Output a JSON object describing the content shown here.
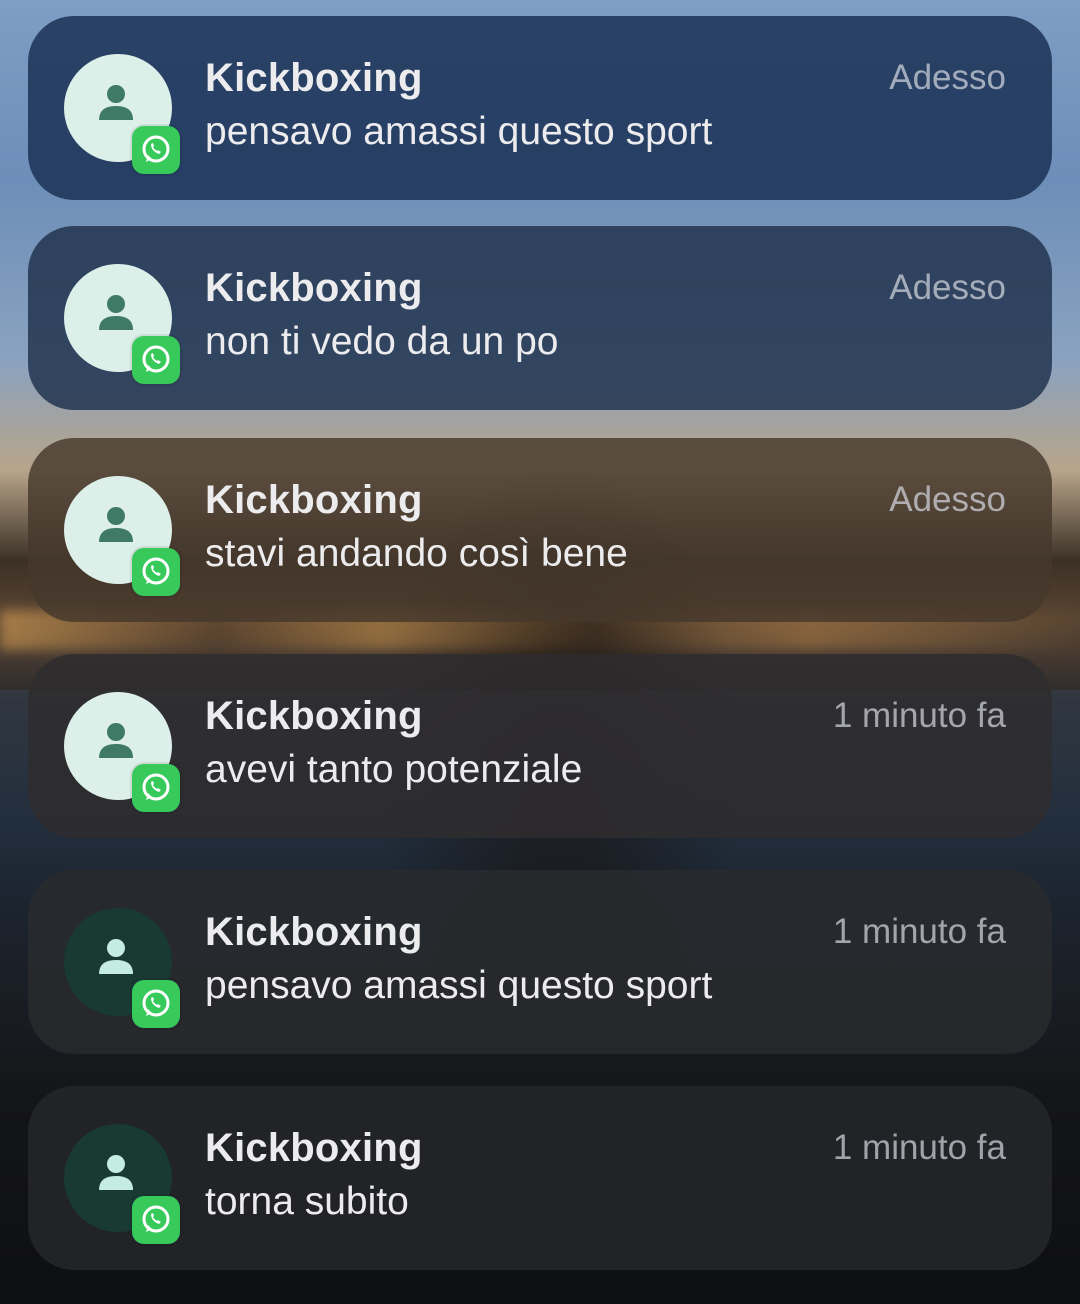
{
  "colors": {
    "badge_green": "#37c95a",
    "avatar_light": "#dcefe9",
    "avatar_dark": "#183a32",
    "text_primary": "#ececee"
  },
  "notifications": [
    {
      "app_icon": "whatsapp-icon",
      "avatar_icon": "person-icon",
      "title": "Kickboxing",
      "message": "pensavo amassi questo sport",
      "time": "Adesso"
    },
    {
      "app_icon": "whatsapp-icon",
      "avatar_icon": "person-icon",
      "title": "Kickboxing",
      "message": "non ti vedo da un po",
      "time": "Adesso"
    },
    {
      "app_icon": "whatsapp-icon",
      "avatar_icon": "person-icon",
      "title": "Kickboxing",
      "message": "stavi andando così bene",
      "time": "Adesso"
    },
    {
      "app_icon": "whatsapp-icon",
      "avatar_icon": "person-icon",
      "title": "Kickboxing",
      "message": "avevi tanto potenziale",
      "time": "1 minuto fa"
    },
    {
      "app_icon": "whatsapp-icon",
      "avatar_icon": "person-icon",
      "title": "Kickboxing",
      "message": "pensavo amassi questo sport",
      "time": "1 minuto fa"
    },
    {
      "app_icon": "whatsapp-icon",
      "avatar_icon": "person-icon",
      "title": "Kickboxing",
      "message": "torna subito",
      "time": "1 minuto fa"
    }
  ]
}
